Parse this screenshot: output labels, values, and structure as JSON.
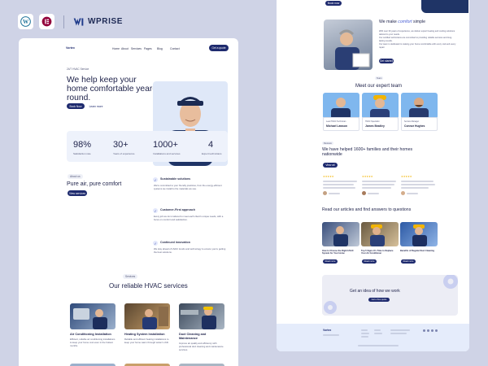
{
  "brand": {
    "name": "WPRISE"
  },
  "left": {
    "logo": "Vortex",
    "nav": [
      "Home",
      "About",
      "Services",
      "Pages",
      "Blog",
      "Contact"
    ],
    "nav_cta": "Get a quote",
    "hero": {
      "eyebrow": "24/7 HVAC Service",
      "title": "We help keep your home comfortable year-round.",
      "primary": "Book Now",
      "secondary": "Learn more"
    },
    "stats": [
      {
        "value": "98%",
        "label": "Satisfaction rate"
      },
      {
        "value": "30+",
        "label": "Years of experience"
      },
      {
        "value": "1000+",
        "label": "Installations and services"
      },
      {
        "value": "4",
        "label": "Expert technicians"
      }
    ],
    "about": {
      "tag": "About us",
      "title": "Pure air, pure comfort",
      "cta": "View services",
      "features": [
        {
          "title": "Sustainable solutions",
          "text": "We're committed to your friendly practices, from the energy-efficient systems we install to the materials we use."
        },
        {
          "title": "Customer-First approach",
          "text": "Every job we do is tailored to meet each client's unique needs, with a focus on comfort and satisfaction."
        },
        {
          "title": "Continued innovation",
          "text": "We stay ahead of HVAC trends and technology to ensure you're getting the best solutions."
        }
      ]
    },
    "services": {
      "tag": "Services",
      "title": "Our reliable HVAC services",
      "items": [
        {
          "title": "Air Conditioning Installation",
          "text": "Efficient, reliable air conditioning installations to keep your home cool even in the hottest months."
        },
        {
          "title": "Heating System Installation",
          "text": "Reliable and efficient heating installations to keep your home warm through winter's chill."
        },
        {
          "title": "Duct Cleaning and Maintenance",
          "text": "Improve air quality and efficiency with professional duct cleaning and maintenance services."
        }
      ]
    }
  },
  "right": {
    "top_cta": "Book now",
    "about": {
      "title_pre": "We make ",
      "title_accent": "comfort",
      "title_post": " simple",
      "bullets": [
        "With over 30 years of experience, we deliver expert heating and cooling solutions tailored to your needs.",
        "Our certified technicians are committed to providing reliable services and long-lasting results.",
        "Our team is dedicated to making your home comfortable with every visit and every repair."
      ],
      "cta": "Get started"
    },
    "team": {
      "tag": "Team",
      "title": "Meet our expert team",
      "members": [
        {
          "role": "Lead HVAC Technician",
          "name": "Michael Lawson"
        },
        {
          "role": "HVAC Specialist",
          "name": "James Bradley"
        },
        {
          "role": "Service Manager",
          "name": "Connor Hughes"
        }
      ]
    },
    "testimonials": {
      "tag": "Reviews",
      "title": "We have helped 1600+ families and their homes nationwide",
      "cta": "View all",
      "stars": "★★★★★"
    },
    "blog": {
      "title": "Read our articles and find answers to questions",
      "posts": [
        {
          "title": "How to Choose the Right HVAC System for Your Home",
          "cta": "Read more"
        },
        {
          "title": "Top 5 Signs It's Time to Replace Your Air Conditioner",
          "cta": "Read more"
        },
        {
          "title": "Benefits of Regular Duct Cleaning",
          "cta": "Read more"
        }
      ]
    },
    "cta_box": {
      "title": "Get an idea of how we work",
      "button": "Get a free quote"
    },
    "footer": {
      "logo": "Vortex"
    }
  }
}
